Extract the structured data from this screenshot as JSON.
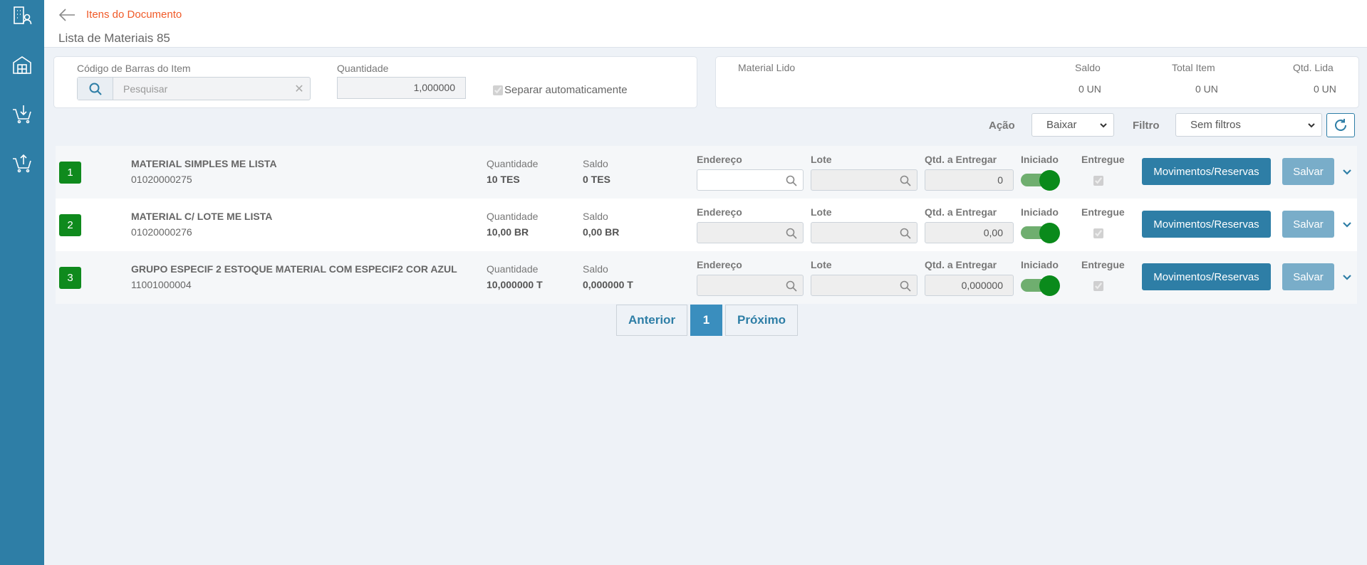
{
  "header": {
    "breadcrumb": "Itens do Documento",
    "title": "Lista de Materiais 85"
  },
  "sidebar": {
    "items": [
      {
        "icon": "building-user-icon"
      },
      {
        "icon": "warehouse-icon"
      },
      {
        "icon": "cart-down-icon"
      },
      {
        "icon": "cart-up-icon"
      }
    ]
  },
  "scan": {
    "barcode_label": "Código de Barras do Item",
    "search_placeholder": "Pesquisar",
    "quantity_label": "Quantidade",
    "quantity_value": "1,000000",
    "auto_separate_label": "Separar automaticamente"
  },
  "summary": {
    "material_label": "Material Lido",
    "saldo_label": "Saldo",
    "total_label": "Total Item",
    "qtd_label": "Qtd. Lida",
    "saldo_value": "0 UN",
    "total_value": "0 UN",
    "qtd_value": "0 UN"
  },
  "toolbar": {
    "action_label": "Ação",
    "action_value": "Baixar",
    "filter_label": "Filtro",
    "filter_value": "Sem filtros"
  },
  "columns": {
    "quantidade": "Quantidade",
    "saldo": "Saldo",
    "endereco": "Endereço",
    "lote": "Lote",
    "qtd_entregar": "Qtd. a Entregar",
    "iniciado": "Iniciado",
    "entregue": "Entregue"
  },
  "buttons": {
    "movements": "Movimentos/Reservas",
    "save": "Salvar"
  },
  "items": [
    {
      "num": "1",
      "name": "MATERIAL SIMPLES ME LISTA",
      "code": "01020000275",
      "quantidade": "10 TES",
      "saldo": "0 TES",
      "qtd_entregar": "0"
    },
    {
      "num": "2",
      "name": "MATERIAL C/ LOTE ME LISTA",
      "code": "01020000276",
      "quantidade": "10,00 BR",
      "saldo": "0,00 BR",
      "qtd_entregar": "0,00"
    },
    {
      "num": "3",
      "name": "GRUPO ESPECIF 2 ESTOQUE MATERIAL COM ESPECIF2 COR AZUL",
      "code": "11001000004",
      "quantidade": "10,000000 T",
      "saldo": "0,000000 T",
      "qtd_entregar": "0,000000"
    }
  ],
  "pagination": {
    "prev": "Anterior",
    "current": "1",
    "next": "Próximo"
  }
}
